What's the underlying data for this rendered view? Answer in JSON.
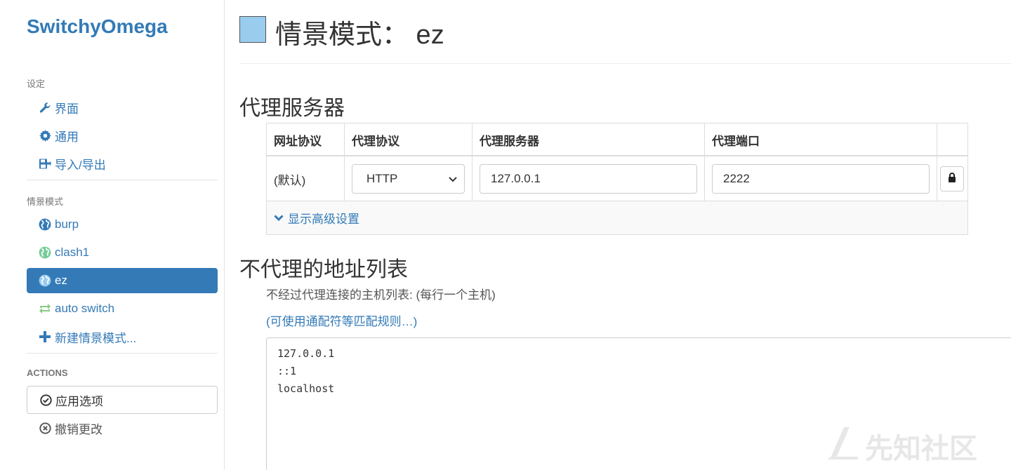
{
  "brand": "SwitchyOmega",
  "sidebar": {
    "settings_header": "设定",
    "settings_items": [
      {
        "label": "界面",
        "icon": "wrench-icon"
      },
      {
        "label": "通用",
        "icon": "gear-icon"
      },
      {
        "label": "导入/导出",
        "icon": "import-export-icon"
      }
    ],
    "profiles_header": "情景模式",
    "profile_items": [
      {
        "label": "burp",
        "icon": "globe-icon",
        "color": "#337ab7"
      },
      {
        "label": "clash1",
        "icon": "globe-icon",
        "color": "#77cc99"
      },
      {
        "label": "ez",
        "icon": "globe-icon",
        "color": "#99ccee",
        "active": true
      },
      {
        "label": "auto switch",
        "icon": "switch-icon",
        "color": "#88cc88"
      },
      {
        "label": "新建情景模式...",
        "icon": "plus-icon"
      }
    ],
    "actions_header": "ACTIONS",
    "apply_label": "应用选项",
    "discard_label": "撤销更改"
  },
  "main": {
    "profile_color": "#99ccee",
    "profile_title": "情景模式：  ez",
    "proxy_section_title": "代理服务器",
    "table": {
      "headers": [
        "网址协议",
        "代理协议",
        "代理服务器",
        "代理端口",
        ""
      ],
      "row": {
        "scheme": "(默认)",
        "protocol": "HTTP",
        "server": "127.0.0.1",
        "port": "2222"
      },
      "advanced_label": "显示高级设置"
    },
    "bypass_section_title": "不代理的地址列表",
    "bypass_help": "不经过代理连接的主机列表: (每行一个主机)",
    "bypass_link": "(可使用通配符等匹配规则…)",
    "bypass_list": [
      "127.0.0.1",
      "::1",
      "localhost"
    ]
  },
  "watermark": "先知社区"
}
